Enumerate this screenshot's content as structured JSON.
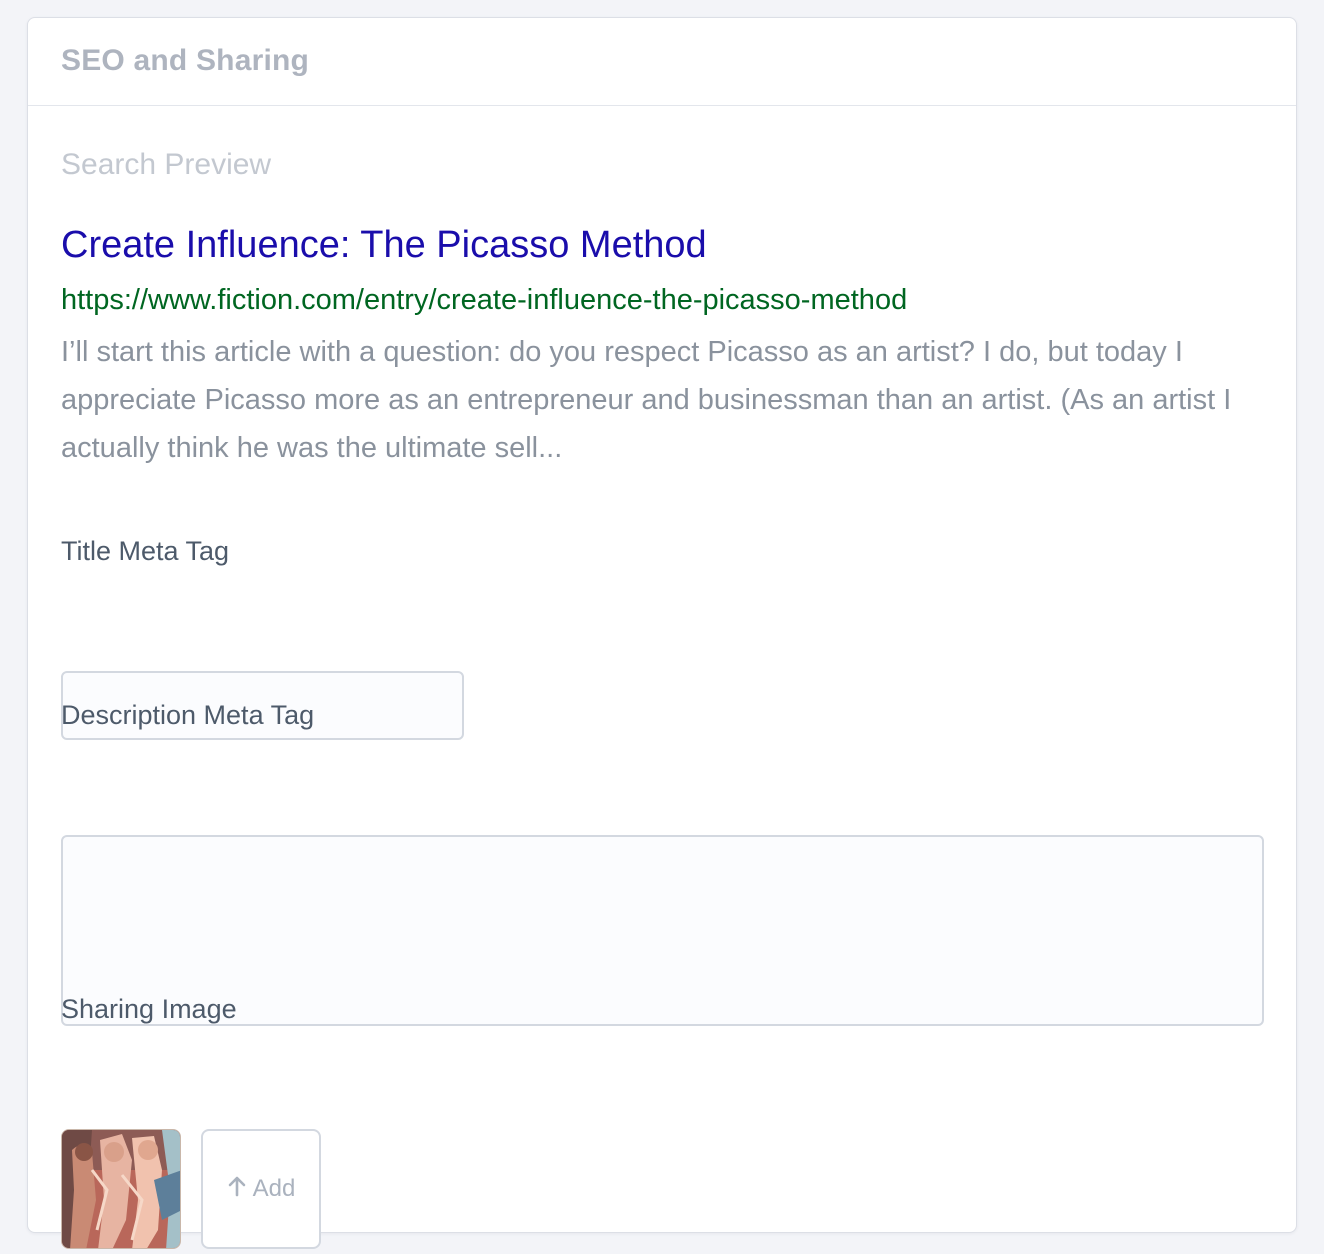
{
  "panel": {
    "title": "SEO and Sharing"
  },
  "preview": {
    "label": "Search Preview",
    "title": "Create Influence: The Picasso Method",
    "url": "https://www.fiction.com/entry/create-influence-the-picasso-method",
    "description": "I’ll start this article with a question: do you respect Picasso as an artist? I do, but today I appreciate Picasso more as an entrepreneur and businessman than an artist. (As an artist I actually think he was the ultimate sell..."
  },
  "fields": {
    "title_meta": {
      "label": "Title Meta Tag",
      "value": "",
      "placeholder": ""
    },
    "description_meta": {
      "label": "Description Meta Tag",
      "value": "",
      "placeholder": ""
    },
    "sharing_image": {
      "label": "Sharing Image",
      "thumbnail_icon": "picasso-painting-thumbnail",
      "add_label": "Add",
      "add_icon": "arrow-up-icon"
    }
  },
  "colors": {
    "preview_title": "#1a0dab",
    "preview_url": "#006621",
    "preview_desc": "#8a929d",
    "header_text": "#aeb4bf"
  }
}
